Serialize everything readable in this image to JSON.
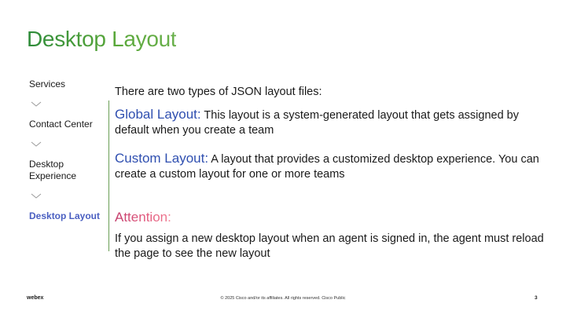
{
  "slide": {
    "title": "Desktop Layout"
  },
  "nav": {
    "items": [
      {
        "label": "Services",
        "active": false
      },
      {
        "label": "Contact Center",
        "active": false
      },
      {
        "label": "Desktop Experience",
        "active": false
      },
      {
        "label": "Desktop Layout",
        "active": true
      }
    ]
  },
  "content": {
    "intro": "There are two types of JSON layout files:",
    "global_keyword": "Global Layout:",
    "global_text": " This layout is a system-generated layout that gets assigned by default when you create a team",
    "custom_keyword": "Custom Layout:",
    "custom_text": " A layout that provides a customized desktop experience. You can create a custom layout for one or more teams",
    "attention_heading": "Attention:",
    "attention_text": "If you assign a new desktop layout when an agent is signed in, the agent must reload the page to see the new layout"
  },
  "footer": {
    "logo": "webex",
    "copyright": "© 2025 Cisco and/or its affiliates. All rights reserved. Cisco Public",
    "page_number": "3"
  },
  "colors": {
    "title": "#3a8c2e",
    "keyword": "#2f4fb0",
    "active_nav": "#4a5fc1",
    "attention": "#d9486f",
    "divider": "#6a9e55"
  }
}
